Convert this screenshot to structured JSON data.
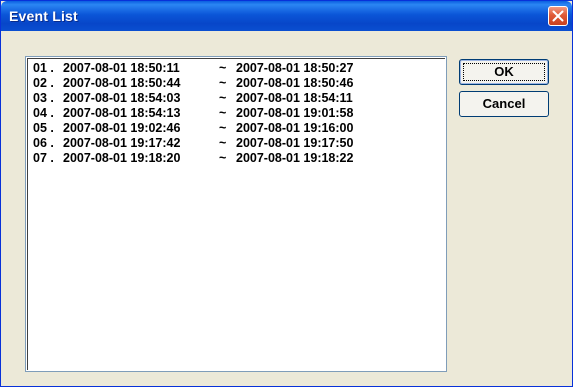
{
  "window": {
    "title": "Event List"
  },
  "buttons": {
    "ok": "OK",
    "cancel": "Cancel"
  },
  "events": [
    {
      "num": "01 .",
      "start": "2007-08-01 18:50:11",
      "sep": "~",
      "end": "2007-08-01 18:50:27"
    },
    {
      "num": "02 .",
      "start": "2007-08-01 18:50:44",
      "sep": "~",
      "end": "2007-08-01 18:50:46"
    },
    {
      "num": "03 .",
      "start": "2007-08-01 18:54:03",
      "sep": "~",
      "end": "2007-08-01 18:54:11"
    },
    {
      "num": "04 .",
      "start": "2007-08-01 18:54:13",
      "sep": "~",
      "end": "2007-08-01 19:01:58"
    },
    {
      "num": "05 .",
      "start": "2007-08-01 19:02:46",
      "sep": "~",
      "end": "2007-08-01 19:16:00"
    },
    {
      "num": "06 .",
      "start": "2007-08-01 19:17:42",
      "sep": "~",
      "end": "2007-08-01 19:17:50"
    },
    {
      "num": "07 .",
      "start": "2007-08-01 19:18:20",
      "sep": "~",
      "end": "2007-08-01 19:18:22"
    }
  ]
}
